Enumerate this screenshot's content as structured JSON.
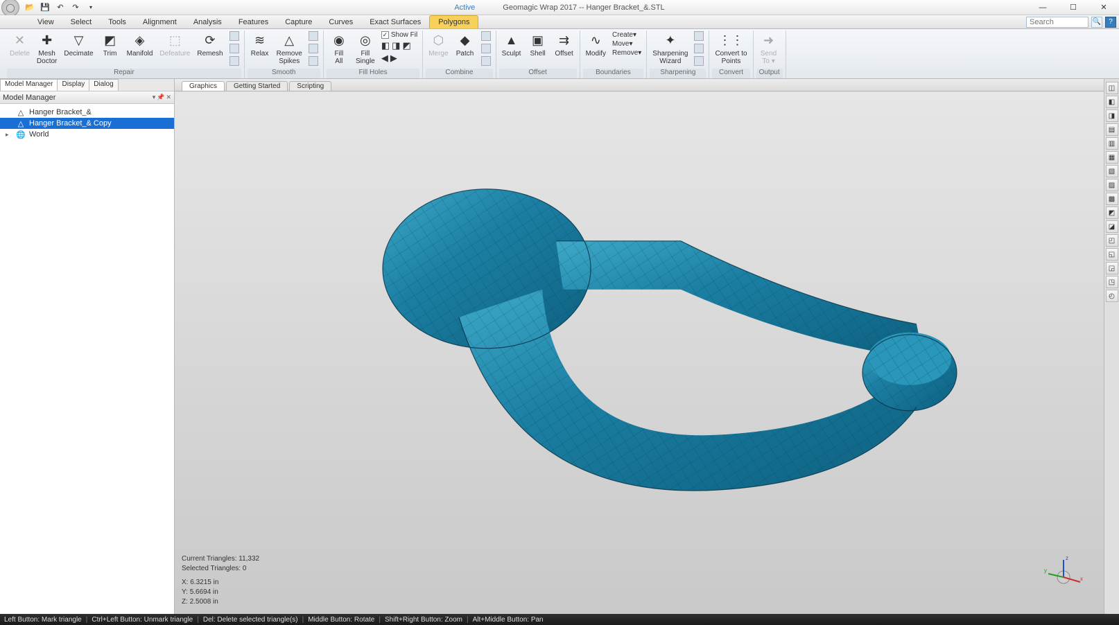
{
  "title": {
    "active": "Active",
    "app": "Geomagic Wrap 2017 -- Hanger Bracket_&.STL"
  },
  "qat_icons": [
    "folder-icon",
    "save-icon",
    "undo-icon",
    "redo-icon"
  ],
  "menu": {
    "items": [
      "View",
      "Select",
      "Tools",
      "Alignment",
      "Analysis",
      "Features",
      "Capture",
      "Curves",
      "Exact Surfaces",
      "Polygons"
    ],
    "active_index": 9,
    "search_placeholder": "Search"
  },
  "ribbon": {
    "groups": [
      {
        "label": "Repair",
        "buttons": [
          {
            "label": "Delete",
            "icon": "✕",
            "disabled": true
          },
          {
            "label": "Mesh\nDoctor",
            "icon": "✚"
          },
          {
            "label": "Decimate",
            "icon": "▽"
          },
          {
            "label": "Trim",
            "icon": "◩"
          },
          {
            "label": "Manifold",
            "icon": "◈"
          },
          {
            "label": "Defeature",
            "icon": "⬚",
            "disabled": true
          },
          {
            "label": "Remesh",
            "icon": "⟳"
          }
        ],
        "extras": true
      },
      {
        "label": "Smooth",
        "buttons": [
          {
            "label": "Relax",
            "icon": "≋"
          },
          {
            "label": "Remove\nSpikes",
            "icon": "△"
          }
        ],
        "extras": true
      },
      {
        "label": "Fill Holes",
        "buttons": [
          {
            "label": "Fill\nAll",
            "icon": "◉"
          },
          {
            "label": "Fill\nSingle",
            "icon": "◎"
          }
        ],
        "extras_row": {
          "checkbox_label": "Show Fil",
          "nav": true
        }
      },
      {
        "label": "Combine",
        "buttons": [
          {
            "label": "Merge",
            "icon": "⬡",
            "disabled": true
          },
          {
            "label": "Patch",
            "icon": "◆"
          }
        ],
        "extras": true
      },
      {
        "label": "Offset",
        "buttons": [
          {
            "label": "Sculpt",
            "icon": "▲"
          },
          {
            "label": "Shell",
            "icon": "▣"
          },
          {
            "label": "Offset",
            "icon": "⇉"
          }
        ]
      },
      {
        "label": "Boundaries",
        "buttons": [
          {
            "label": "Modify",
            "icon": "∿"
          }
        ],
        "menu_items": [
          "Create▾",
          "Move▾",
          "Remove▾"
        ]
      },
      {
        "label": "Sharpening",
        "buttons": [
          {
            "label": "Sharpening\nWizard",
            "icon": "✦"
          }
        ],
        "extras": true
      },
      {
        "label": "Convert",
        "buttons": [
          {
            "label": "Convert to\nPoints",
            "icon": "⋮⋮"
          }
        ]
      },
      {
        "label": "Output",
        "buttons": [
          {
            "label": "Send\nTo ▾",
            "icon": "➜",
            "disabled": true
          }
        ]
      }
    ]
  },
  "left_tabs": {
    "items": [
      "Model Manager",
      "Display",
      "Dialog"
    ],
    "active_index": 0
  },
  "left_header": "Model Manager",
  "tree": [
    {
      "label": "Hanger Bracket_&",
      "icon": "△",
      "selected": false,
      "indent": 1
    },
    {
      "label": "Hanger Bracket_& Copy",
      "icon": "△",
      "selected": true,
      "indent": 1
    },
    {
      "label": "World",
      "icon": "🌐",
      "selected": false,
      "indent": 1,
      "expandable": true
    }
  ],
  "center_tabs": {
    "items": [
      "Graphics",
      "Getting Started",
      "Scripting"
    ],
    "active_index": 0
  },
  "view_info": {
    "triangles_label": "Current Triangles:",
    "triangles": "11,332",
    "selected_label": "Selected Triangles:",
    "selected": "0",
    "x_label": "X:",
    "x": "6.3215 in",
    "y_label": "Y:",
    "y": "5.6694 in",
    "z_label": "Z:",
    "z": "2.5008 in"
  },
  "right_tools": [
    "◫",
    "◧",
    "◨",
    "▤",
    "▥",
    "▦",
    "▧",
    "▨",
    "▩",
    "◩",
    "◪",
    "◰",
    "◱",
    "◲",
    "◳",
    "◴"
  ],
  "status": {
    "segments": [
      "Left Button: Mark triangle",
      "Ctrl+Left Button: Unmark triangle",
      "Del: Delete selected triangle(s)",
      "Middle Button: Rotate",
      "Shift+Right Button: Zoom",
      "Alt+Middle Button: Pan"
    ]
  }
}
